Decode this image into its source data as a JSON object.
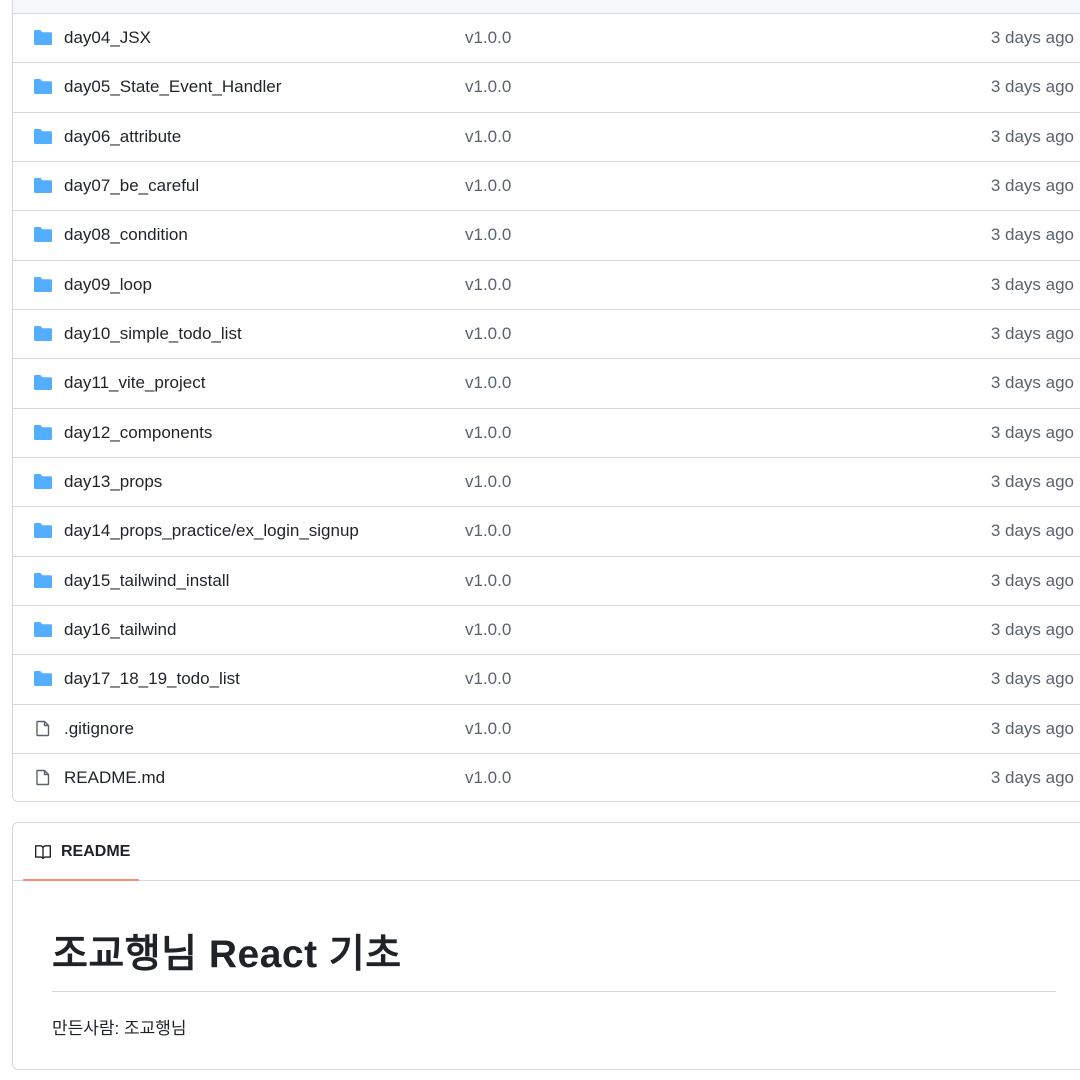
{
  "files": [
    {
      "type": "folder",
      "name": "day04_JSX",
      "commit": "v1.0.0",
      "age": "3 days ago"
    },
    {
      "type": "folder",
      "name": "day05_State_Event_Handler",
      "commit": "v1.0.0",
      "age": "3 days ago"
    },
    {
      "type": "folder",
      "name": "day06_attribute",
      "commit": "v1.0.0",
      "age": "3 days ago"
    },
    {
      "type": "folder",
      "name": "day07_be_careful",
      "commit": "v1.0.0",
      "age": "3 days ago"
    },
    {
      "type": "folder",
      "name": "day08_condition",
      "commit": "v1.0.0",
      "age": "3 days ago"
    },
    {
      "type": "folder",
      "name": "day09_loop",
      "commit": "v1.0.0",
      "age": "3 days ago"
    },
    {
      "type": "folder",
      "name": "day10_simple_todo_list",
      "commit": "v1.0.0",
      "age": "3 days ago"
    },
    {
      "type": "folder",
      "name": "day11_vite_project",
      "commit": "v1.0.0",
      "age": "3 days ago"
    },
    {
      "type": "folder",
      "name": "day12_components",
      "commit": "v1.0.0",
      "age": "3 days ago"
    },
    {
      "type": "folder",
      "name": "day13_props",
      "commit": "v1.0.0",
      "age": "3 days ago"
    },
    {
      "type": "folder",
      "name": "day14_props_practice/ex_login_signup",
      "commit": "v1.0.0",
      "age": "3 days ago"
    },
    {
      "type": "folder",
      "name": "day15_tailwind_install",
      "commit": "v1.0.0",
      "age": "3 days ago"
    },
    {
      "type": "folder",
      "name": "day16_tailwind",
      "commit": "v1.0.0",
      "age": "3 days ago"
    },
    {
      "type": "folder",
      "name": "day17_18_19_todo_list",
      "commit": "v1.0.0",
      "age": "3 days ago"
    },
    {
      "type": "file",
      "name": ".gitignore",
      "commit": "v1.0.0",
      "age": "3 days ago"
    },
    {
      "type": "file",
      "name": "README.md",
      "commit": "v1.0.0",
      "age": "3 days ago"
    }
  ],
  "readme": {
    "tab_label": "README",
    "title": "조교행님 React 기초",
    "author_line": "만든사람: 조교행님"
  },
  "colors": {
    "folder_icon": "#54aeff",
    "file_icon": "#59636e",
    "tab_underline": "#fd8c73",
    "border": "#d1d9e0"
  }
}
